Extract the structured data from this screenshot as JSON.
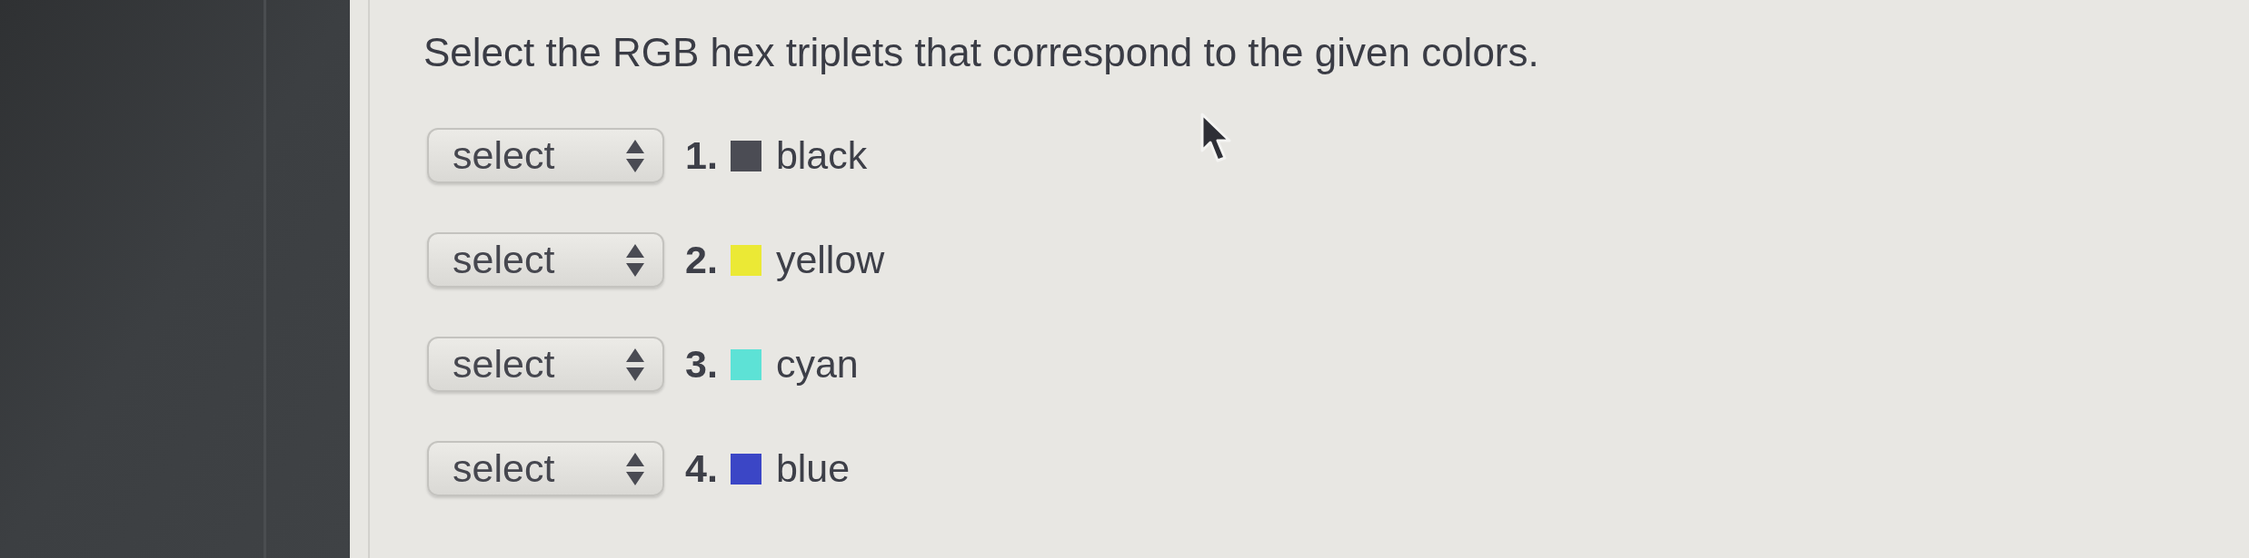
{
  "question": {
    "prompt": "Select the RGB hex triplets that correspond to the given colors."
  },
  "items": [
    {
      "dropdown": {
        "value": "select"
      },
      "number": "1.",
      "color": "#4b4c54",
      "label": "black"
    },
    {
      "dropdown": {
        "value": "select"
      },
      "number": "2.",
      "color": "#ebe935",
      "label": "yellow"
    },
    {
      "dropdown": {
        "value": "select"
      },
      "number": "3.",
      "color": "#5de2d6",
      "label": "cyan"
    },
    {
      "dropdown": {
        "value": "select"
      },
      "number": "4.",
      "color": "#3b46c6",
      "label": "blue"
    }
  ]
}
